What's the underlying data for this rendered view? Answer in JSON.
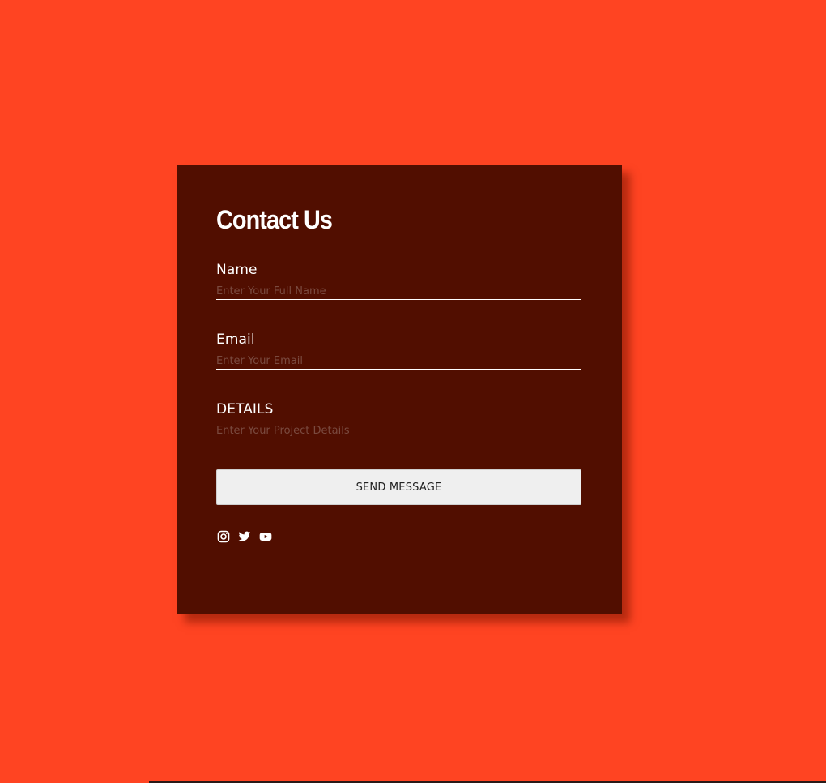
{
  "colors": {
    "page_background": "#ff4422",
    "card_background": "#510e00",
    "text": "#ffffff",
    "button_background": "#efefef",
    "button_text": "#222222"
  },
  "contact_form": {
    "title": "Contact Us",
    "fields": [
      {
        "label": "Name",
        "placeholder": "Enter Your Full Name",
        "value": ""
      },
      {
        "label": "Email",
        "placeholder": "Enter Your Email",
        "value": ""
      },
      {
        "label": "DETAILS",
        "placeholder": "Enter Your Project Details",
        "value": ""
      }
    ],
    "submit_label": "SEND MESSAGE",
    "social_icons": [
      "instagram-icon",
      "twitter-icon",
      "youtube-icon"
    ]
  }
}
